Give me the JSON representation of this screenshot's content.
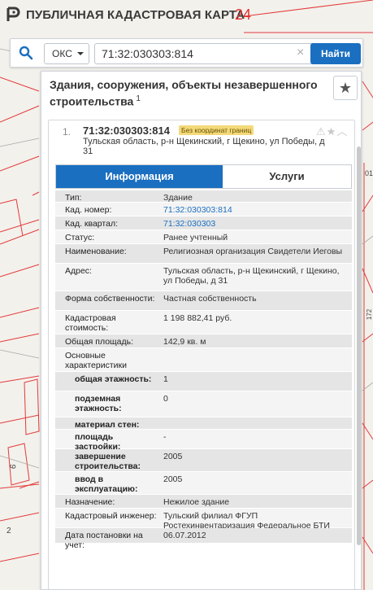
{
  "header": {
    "title": "ПУБЛИЧНАЯ КАДАСТРОВАЯ КАРТА",
    "overlay_number": "24"
  },
  "search": {
    "type_value": "ОКС",
    "query": "71:32:030303:814",
    "find_label": "Найти"
  },
  "panel": {
    "title": "Здания, сооружения, объекты незавершенного строительства",
    "count": "1"
  },
  "card": {
    "index": "1.",
    "number": "71:32:030303:814",
    "badge": "Без координат границ",
    "address": "Тульская область, р-н Щекинский, г Щекино, ул Победы, д 31",
    "tabs": {
      "info": "Информация",
      "services": "Услуги"
    },
    "rows": [
      {
        "label": "Тип:",
        "value": "Здание"
      },
      {
        "label": "Кад. номер:",
        "value": "71:32:030303:814",
        "link": true
      },
      {
        "label": "Кад. квартал:",
        "value": "71:32:030303",
        "link": true
      },
      {
        "label": "Статус:",
        "value": "Ранее учтенный"
      },
      {
        "label": "Наименование:",
        "value": "Религиозная организация Свидетели Иеговы"
      },
      {
        "label": "Адрес:",
        "value": "Тульская область, р-н Щекинский, г Щекино, ул Победы, д 31"
      },
      {
        "label": "Форма собственности:",
        "value": "Частная собственность"
      },
      {
        "label": "Кадастровая стоимость:",
        "value": "1 198 882,41 руб."
      },
      {
        "label": "Общая площадь:",
        "value": "142,9 кв. м"
      },
      {
        "label": "Основные характеристики",
        "value": ""
      },
      {
        "label": "общая этажность:",
        "value": "1",
        "sub": true
      },
      {
        "label": "подземная этажность:",
        "value": "0",
        "sub": true
      },
      {
        "label": "материал стен:",
        "value": "",
        "sub": true
      },
      {
        "label": "площадь застройки:",
        "value": "-",
        "sub": true
      },
      {
        "label": "завершение строительства:",
        "value": "2005",
        "sub": true
      },
      {
        "label": "ввод в эксплуатацию:",
        "value": "2005",
        "sub": true
      },
      {
        "label": "Назначение:",
        "value": "Нежилое здание"
      },
      {
        "label": "Кадастровый инженер:",
        "value": "Тульский филиал ФГУП Ростехинвентаризация Федеральное БТИ"
      },
      {
        "label": "Дата постановки на учет:",
        "value": "06.07.2012"
      }
    ]
  },
  "map_labels": [
    "6",
    "2",
    "172",
    "01"
  ]
}
